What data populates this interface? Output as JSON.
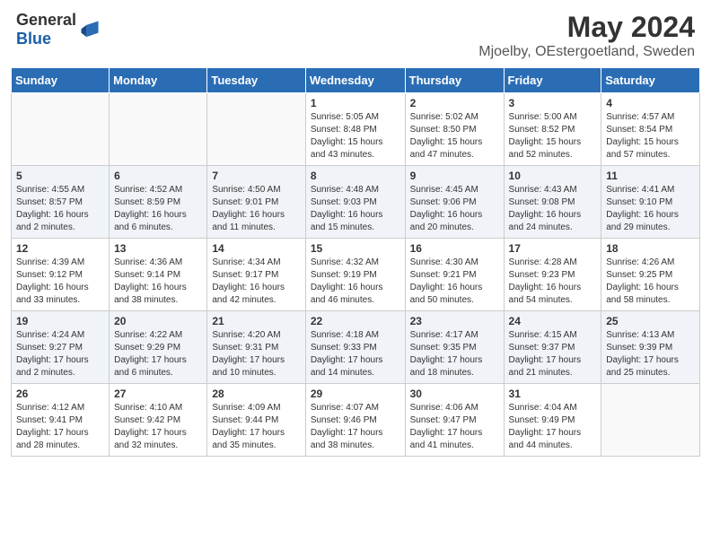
{
  "header": {
    "logo_general": "General",
    "logo_blue": "Blue",
    "title": "May 2024",
    "subtitle": "Mjoelby, OEstergoetland, Sweden"
  },
  "weekdays": [
    "Sunday",
    "Monday",
    "Tuesday",
    "Wednesday",
    "Thursday",
    "Friday",
    "Saturday"
  ],
  "weeks": [
    [
      {
        "day": "",
        "info": ""
      },
      {
        "day": "",
        "info": ""
      },
      {
        "day": "",
        "info": ""
      },
      {
        "day": "1",
        "info": "Sunrise: 5:05 AM\nSunset: 8:48 PM\nDaylight: 15 hours\nand 43 minutes."
      },
      {
        "day": "2",
        "info": "Sunrise: 5:02 AM\nSunset: 8:50 PM\nDaylight: 15 hours\nand 47 minutes."
      },
      {
        "day": "3",
        "info": "Sunrise: 5:00 AM\nSunset: 8:52 PM\nDaylight: 15 hours\nand 52 minutes."
      },
      {
        "day": "4",
        "info": "Sunrise: 4:57 AM\nSunset: 8:54 PM\nDaylight: 15 hours\nand 57 minutes."
      }
    ],
    [
      {
        "day": "5",
        "info": "Sunrise: 4:55 AM\nSunset: 8:57 PM\nDaylight: 16 hours\nand 2 minutes."
      },
      {
        "day": "6",
        "info": "Sunrise: 4:52 AM\nSunset: 8:59 PM\nDaylight: 16 hours\nand 6 minutes."
      },
      {
        "day": "7",
        "info": "Sunrise: 4:50 AM\nSunset: 9:01 PM\nDaylight: 16 hours\nand 11 minutes."
      },
      {
        "day": "8",
        "info": "Sunrise: 4:48 AM\nSunset: 9:03 PM\nDaylight: 16 hours\nand 15 minutes."
      },
      {
        "day": "9",
        "info": "Sunrise: 4:45 AM\nSunset: 9:06 PM\nDaylight: 16 hours\nand 20 minutes."
      },
      {
        "day": "10",
        "info": "Sunrise: 4:43 AM\nSunset: 9:08 PM\nDaylight: 16 hours\nand 24 minutes."
      },
      {
        "day": "11",
        "info": "Sunrise: 4:41 AM\nSunset: 9:10 PM\nDaylight: 16 hours\nand 29 minutes."
      }
    ],
    [
      {
        "day": "12",
        "info": "Sunrise: 4:39 AM\nSunset: 9:12 PM\nDaylight: 16 hours\nand 33 minutes."
      },
      {
        "day": "13",
        "info": "Sunrise: 4:36 AM\nSunset: 9:14 PM\nDaylight: 16 hours\nand 38 minutes."
      },
      {
        "day": "14",
        "info": "Sunrise: 4:34 AM\nSunset: 9:17 PM\nDaylight: 16 hours\nand 42 minutes."
      },
      {
        "day": "15",
        "info": "Sunrise: 4:32 AM\nSunset: 9:19 PM\nDaylight: 16 hours\nand 46 minutes."
      },
      {
        "day": "16",
        "info": "Sunrise: 4:30 AM\nSunset: 9:21 PM\nDaylight: 16 hours\nand 50 minutes."
      },
      {
        "day": "17",
        "info": "Sunrise: 4:28 AM\nSunset: 9:23 PM\nDaylight: 16 hours\nand 54 minutes."
      },
      {
        "day": "18",
        "info": "Sunrise: 4:26 AM\nSunset: 9:25 PM\nDaylight: 16 hours\nand 58 minutes."
      }
    ],
    [
      {
        "day": "19",
        "info": "Sunrise: 4:24 AM\nSunset: 9:27 PM\nDaylight: 17 hours\nand 2 minutes."
      },
      {
        "day": "20",
        "info": "Sunrise: 4:22 AM\nSunset: 9:29 PM\nDaylight: 17 hours\nand 6 minutes."
      },
      {
        "day": "21",
        "info": "Sunrise: 4:20 AM\nSunset: 9:31 PM\nDaylight: 17 hours\nand 10 minutes."
      },
      {
        "day": "22",
        "info": "Sunrise: 4:18 AM\nSunset: 9:33 PM\nDaylight: 17 hours\nand 14 minutes."
      },
      {
        "day": "23",
        "info": "Sunrise: 4:17 AM\nSunset: 9:35 PM\nDaylight: 17 hours\nand 18 minutes."
      },
      {
        "day": "24",
        "info": "Sunrise: 4:15 AM\nSunset: 9:37 PM\nDaylight: 17 hours\nand 21 minutes."
      },
      {
        "day": "25",
        "info": "Sunrise: 4:13 AM\nSunset: 9:39 PM\nDaylight: 17 hours\nand 25 minutes."
      }
    ],
    [
      {
        "day": "26",
        "info": "Sunrise: 4:12 AM\nSunset: 9:41 PM\nDaylight: 17 hours\nand 28 minutes."
      },
      {
        "day": "27",
        "info": "Sunrise: 4:10 AM\nSunset: 9:42 PM\nDaylight: 17 hours\nand 32 minutes."
      },
      {
        "day": "28",
        "info": "Sunrise: 4:09 AM\nSunset: 9:44 PM\nDaylight: 17 hours\nand 35 minutes."
      },
      {
        "day": "29",
        "info": "Sunrise: 4:07 AM\nSunset: 9:46 PM\nDaylight: 17 hours\nand 38 minutes."
      },
      {
        "day": "30",
        "info": "Sunrise: 4:06 AM\nSunset: 9:47 PM\nDaylight: 17 hours\nand 41 minutes."
      },
      {
        "day": "31",
        "info": "Sunrise: 4:04 AM\nSunset: 9:49 PM\nDaylight: 17 hours\nand 44 minutes."
      },
      {
        "day": "",
        "info": ""
      }
    ]
  ]
}
